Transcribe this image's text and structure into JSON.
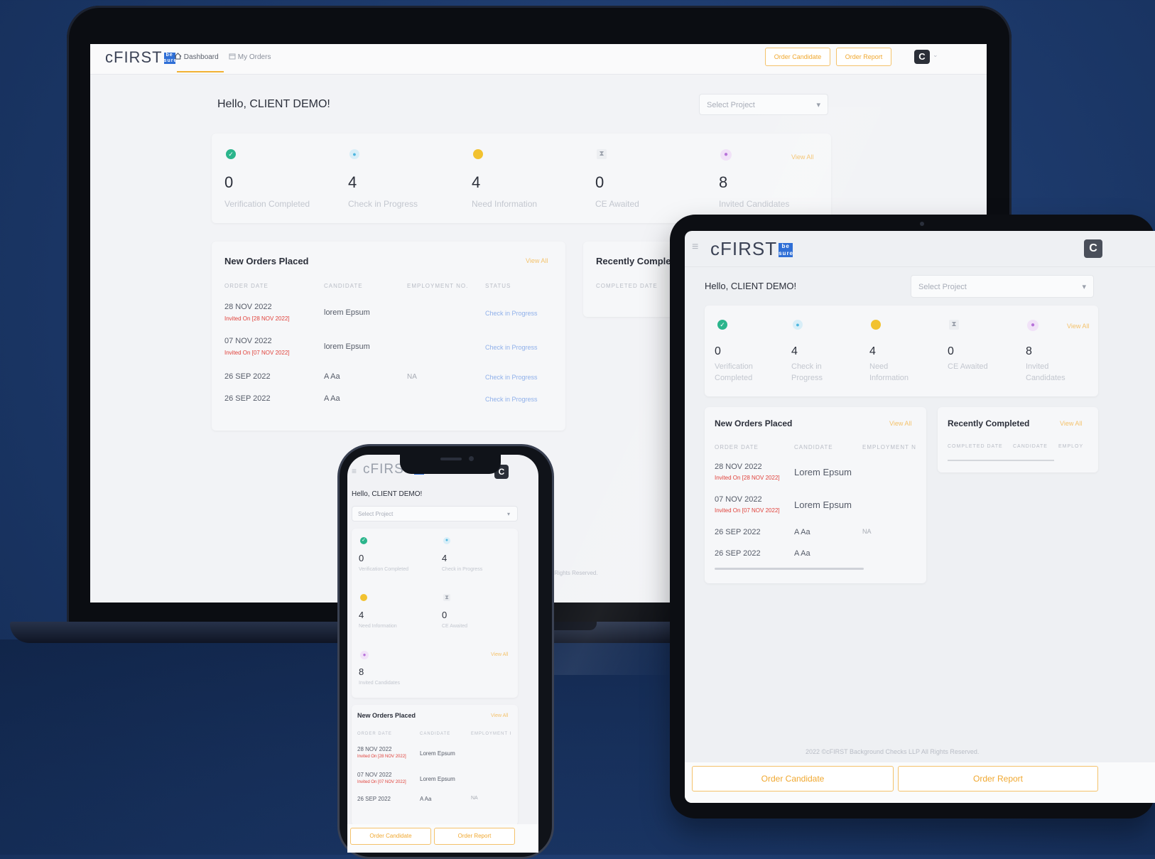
{
  "brand": {
    "logo_text": "cFIRST",
    "logo_mark": "be sure"
  },
  "greeting": "Hello, CLIENT DEMO!",
  "laptop": {
    "nav": [
      {
        "label": "Dashboard",
        "icon": "home-icon",
        "active": true
      },
      {
        "label": "My Orders",
        "icon": "calendar-icon",
        "active": false
      }
    ],
    "buttons": {
      "order_candidate": "Order Candidate",
      "order_report": "Order Report"
    },
    "avatar_letter": "C",
    "select_project_placeholder": "Select Project",
    "stats": [
      {
        "value": "0",
        "label": "Verification Completed",
        "icon": "shield-check-icon",
        "color": "#2bb58c"
      },
      {
        "value": "4",
        "label": "Check in Progress",
        "icon": "user-icon",
        "color": "#4fb7e0"
      },
      {
        "value": "4",
        "label": "Need Information",
        "icon": "info-icon",
        "color": "#f2c230"
      },
      {
        "value": "0",
        "label": "CE Awaited",
        "icon": "hourglass-icon",
        "color": "#9aa0ab"
      },
      {
        "value": "8",
        "label": "Invited Candidates",
        "icon": "users-icon",
        "color": "#b773d9"
      }
    ],
    "stats_view_all": "View All",
    "new_orders": {
      "title": "New Orders Placed",
      "view_all": "View All",
      "columns": [
        "ORDER DATE",
        "CANDIDATE",
        "EMPLOYMENT NO.",
        "STATUS"
      ],
      "rows": [
        {
          "date": "28 NOV 2022",
          "invited": "Invited On [28 NOV 2022]",
          "candidate": "lorem Epsum",
          "employment": "",
          "status": "Check in Progress"
        },
        {
          "date": "07 NOV 2022",
          "invited": "Invited On [07 NOV 2022]",
          "candidate": "lorem Epsum",
          "employment": "",
          "status": "Check in Progress"
        },
        {
          "date": "26 SEP 2022",
          "invited": "",
          "candidate": "A Aa",
          "employment": "NA",
          "status": "Check in Progress"
        },
        {
          "date": "26 SEP 2022",
          "invited": "",
          "candidate": "A Aa",
          "employment": "",
          "status": "Check in Progress"
        }
      ]
    },
    "recently_completed": {
      "title": "Recently Comple",
      "columns": [
        "COMPLETED DATE"
      ]
    },
    "footer": "s LLP All Rights Reserved."
  },
  "tablet": {
    "menu_icon": "hamburger-icon",
    "avatar_letter": "C",
    "select_project_placeholder": "Select Project",
    "stats": [
      {
        "value": "0",
        "label_line1": "Verification",
        "label_line2": "Completed",
        "icon": "shield-check-icon",
        "color": "#2bb58c"
      },
      {
        "value": "4",
        "label_line1": "Check in",
        "label_line2": "Progress",
        "icon": "user-icon",
        "color": "#4fb7e0"
      },
      {
        "value": "4",
        "label_line1": "Need",
        "label_line2": "Information",
        "icon": "info-icon",
        "color": "#f2c230"
      },
      {
        "value": "0",
        "label_line1": "CE Awaited",
        "label_line2": "",
        "icon": "hourglass-icon",
        "color": "#9aa0ab"
      },
      {
        "value": "8",
        "label_line1": "Invited",
        "label_line2": "Candidates",
        "icon": "users-icon",
        "color": "#b773d9"
      }
    ],
    "stats_view_all": "View All",
    "new_orders": {
      "title": "New Orders Placed",
      "view_all": "View All",
      "columns": [
        "ORDER DATE",
        "CANDIDATE",
        "EMPLOYMENT N"
      ],
      "rows": [
        {
          "date": "28 NOV 2022",
          "invited": "Invited On [28 NOV 2022]",
          "candidate": "Lorem Epsum",
          "employment": ""
        },
        {
          "date": "07 NOV 2022",
          "invited": "Invited On [07 NOV 2022]",
          "candidate": "Lorem Epsum",
          "employment": ""
        },
        {
          "date": "26 SEP 2022",
          "invited": "",
          "candidate": "A Aa",
          "employment": "NA"
        },
        {
          "date": "26 SEP 2022",
          "invited": "",
          "candidate": "A Aa",
          "employment": ""
        }
      ]
    },
    "recently_completed": {
      "title": "Recently Completed",
      "view_all": "View All",
      "columns": [
        "COMPLETED DATE",
        "CANDIDATE",
        "EMPLOY"
      ]
    },
    "footer": "2022 ©cFIRST Background Checks LLP All Rights Reserved.",
    "buttons": {
      "order_candidate": "Order Candidate",
      "order_report": "Order Report"
    }
  },
  "phone": {
    "menu_icon": "hamburger-icon",
    "avatar_letter": "C",
    "select_project_placeholder": "Select Project",
    "stats": [
      {
        "value": "0",
        "label": "Verification Completed",
        "icon": "shield-check-icon",
        "color": "#2bb58c"
      },
      {
        "value": "4",
        "label": "Check in Progress",
        "icon": "user-icon",
        "color": "#4fb7e0"
      },
      {
        "value": "4",
        "label": "Need Information",
        "icon": "info-icon",
        "color": "#f2c230"
      },
      {
        "value": "0",
        "label": "CE Awaited",
        "icon": "hourglass-icon",
        "color": "#9aa0ab"
      },
      {
        "value": "8",
        "label": "Invited Candidates",
        "icon": "users-icon",
        "color": "#b773d9"
      }
    ],
    "stats_view_all": "View All",
    "new_orders": {
      "title": "New Orders Placed",
      "view_all": "View All",
      "columns": [
        "ORDER DATE",
        "CANDIDATE",
        "EMPLOYMENT I"
      ],
      "rows": [
        {
          "date": "28 NOV 2022",
          "invited": "Invited On [28 NOV 2022]",
          "candidate": "Lorem Epsum",
          "employment": ""
        },
        {
          "date": "07 NOV 2022",
          "invited": "Invited On [07 NOV 2022]",
          "candidate": "Lorem Epsum",
          "employment": ""
        },
        {
          "date": "26 SEP 2022",
          "invited": "",
          "candidate": "A Aa",
          "employment": "NA"
        }
      ]
    },
    "buttons": {
      "order_candidate": "Order Candidate",
      "order_report": "Order Report"
    }
  },
  "colors": {
    "accent": "#f4c26b",
    "invited_red": "#e0413a",
    "status_blue": "#8fb0ea",
    "background": "#1d3a6c"
  }
}
